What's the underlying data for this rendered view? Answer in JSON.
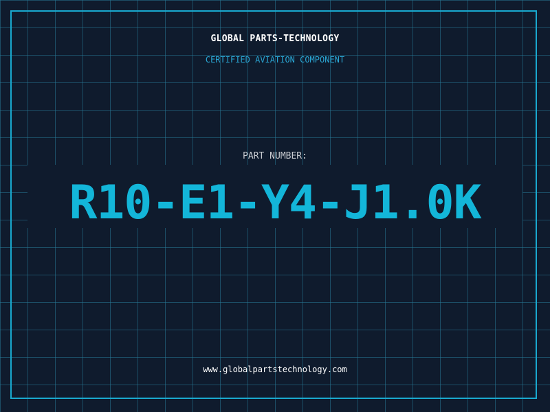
{
  "header": {
    "company_name": "GLOBAL PARTS-TECHNOLOGY",
    "subtitle": "CERTIFIED AVIATION COMPONENT"
  },
  "part": {
    "label": "PART NUMBER:",
    "number": "R10-E1-Y4-J1.0K"
  },
  "footer": {
    "website": "www.globalpartstechnology.com"
  },
  "colors": {
    "background": "#0f1b2d",
    "grid": "#26789a",
    "accent": "#19a9cf",
    "part_number": "#13b6d9",
    "text_primary": "#ffffff",
    "text_secondary": "#c9ccd1"
  }
}
